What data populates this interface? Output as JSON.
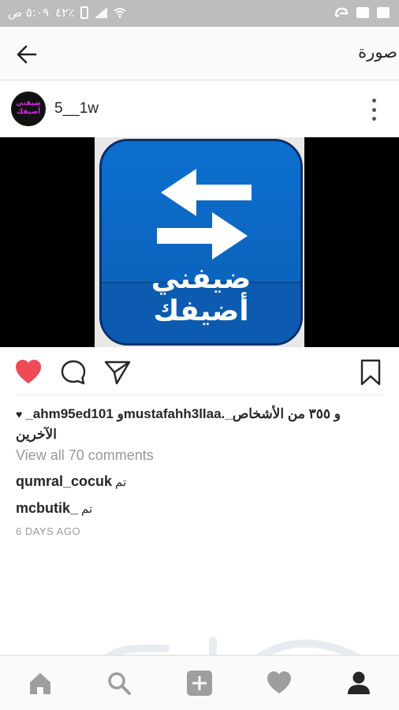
{
  "status_bar": {
    "time": "٥:٠٩ ص",
    "battery": "٤٢٪"
  },
  "top_bar": {
    "title": "صورة",
    "back_icon": "arrow-left-icon"
  },
  "post": {
    "username": "5__1w",
    "avatar_text": "ضيفني أضيفك",
    "image_text": "ضيفني أضيفك",
    "liked": true,
    "likes_line_1": "_ahm95ed101 وmustafahh3llaa._و ٣٥٥ من الأشخاص",
    "likes_line_2": "الآخرين",
    "view_all_comments": "View all 70 comments",
    "comments": [
      {
        "user": "qumral_cocuk",
        "text": "تم"
      },
      {
        "user": "mcbutik_",
        "text": "تم"
      }
    ],
    "time_ago": "6 DAYS AGO"
  },
  "colors": {
    "like_red": "#ed4956",
    "tile_blue": "#0d6fcf",
    "status_gray": "#bdbdbd"
  },
  "bottom_nav": [
    "home-icon",
    "search-icon",
    "add-icon",
    "heart-icon",
    "profile-icon"
  ]
}
